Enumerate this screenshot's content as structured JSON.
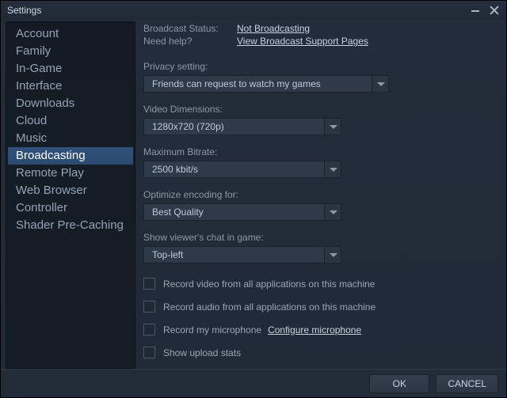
{
  "title": "Settings",
  "sidebar": {
    "items": [
      {
        "label": "Account"
      },
      {
        "label": "Family"
      },
      {
        "label": "In-Game"
      },
      {
        "label": "Interface"
      },
      {
        "label": "Downloads"
      },
      {
        "label": "Cloud"
      },
      {
        "label": "Music"
      },
      {
        "label": "Broadcasting"
      },
      {
        "label": "Remote Play"
      },
      {
        "label": "Web Browser"
      },
      {
        "label": "Controller"
      },
      {
        "label": "Shader Pre-Caching"
      }
    ],
    "active_index": 7
  },
  "panel": {
    "status_label": "Broadcast Status:",
    "status_value": "Not Broadcasting",
    "help_label": "Need help?",
    "help_value": "View Broadcast Support Pages",
    "privacy_label": "Privacy setting:",
    "privacy_value": "Friends can request to watch my games",
    "dimensions_label": "Video Dimensions:",
    "dimensions_value": "1280x720 (720p)",
    "bitrate_label": "Maximum Bitrate:",
    "bitrate_value": "2500 kbit/s",
    "encoding_label": "Optimize encoding for:",
    "encoding_value": "Best Quality",
    "chat_label": "Show viewer's chat in game:",
    "chat_value": "Top-left",
    "chk_video": "Record video from all applications on this machine",
    "chk_audio": "Record audio from all applications on this machine",
    "chk_mic": "Record my microphone",
    "mic_link": "Configure microphone",
    "chk_upload": "Show upload stats"
  },
  "footer": {
    "ok": "OK",
    "cancel": "CANCEL"
  }
}
